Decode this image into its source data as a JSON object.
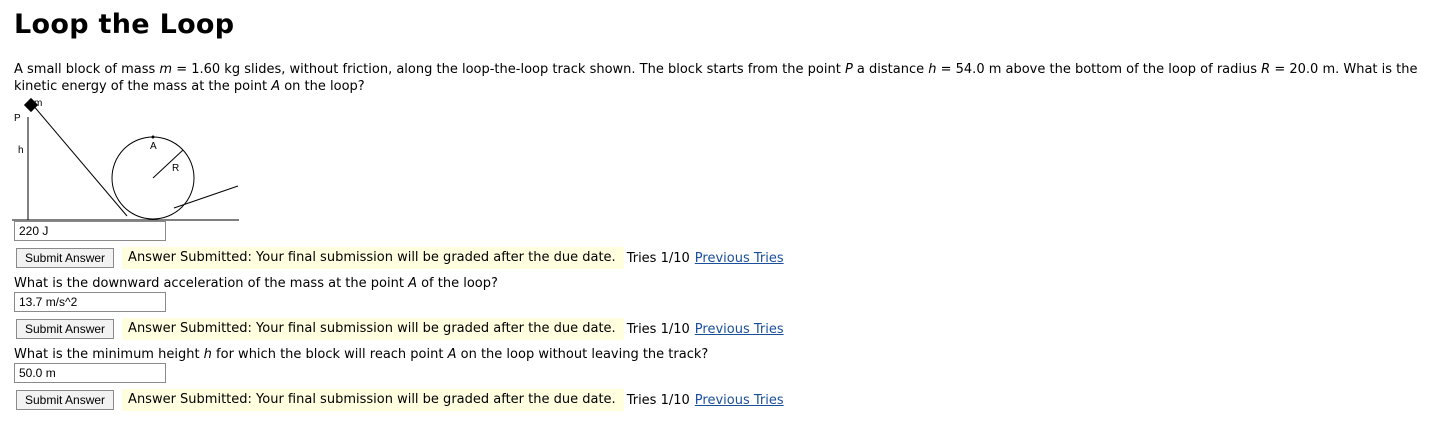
{
  "title": "Loop the Loop",
  "problem": {
    "part1": "A small block of mass ",
    "var_m": "m",
    "part2": " = 1.60 kg slides, without friction, along the loop-the-loop track shown. The block starts from the point ",
    "var_P": "P",
    "part3": " a distance ",
    "var_h": "h",
    "part4": " = 54.0 m above the bottom of the loop of radius ",
    "var_R": "R",
    "part5": " = 20.0 m. What is the kinetic energy of the mass at the point ",
    "var_A": "A",
    "part6": " on the loop?"
  },
  "figure": {
    "label_m": "m",
    "label_P": "P",
    "label_h": "h",
    "label_A": "A",
    "label_R": "R"
  },
  "parts": [
    {
      "answer_value": "220 J",
      "submit_label": "Submit Answer",
      "status_text": "Answer Submitted: Your final submission will be graded after the due date.",
      "tries_text": "Tries 1/10",
      "previous_tries_label": "Previous Tries"
    },
    {
      "question_pre": "What is the downward acceleration of the mass at the point ",
      "question_var": "A",
      "question_post": " of the loop?",
      "answer_value": "13.7 m/s^2",
      "submit_label": "Submit Answer",
      "status_text": "Answer Submitted: Your final submission will be graded after the due date.",
      "tries_text": "Tries 1/10",
      "previous_tries_label": "Previous Tries"
    },
    {
      "question_pre": "What is the minimum height ",
      "question_var": "h",
      "question_mid": " for which the block will reach point ",
      "question_var2": "A",
      "question_post": " on the loop without leaving the track?",
      "answer_value": "50.0 m",
      "submit_label": "Submit Answer",
      "status_text": "Answer Submitted: Your final submission will be graded after the due date.",
      "tries_text": "Tries 1/10",
      "previous_tries_label": "Previous Tries"
    }
  ],
  "colors": {
    "status_background": "#ffffe0",
    "link": "#1a4f9c"
  }
}
